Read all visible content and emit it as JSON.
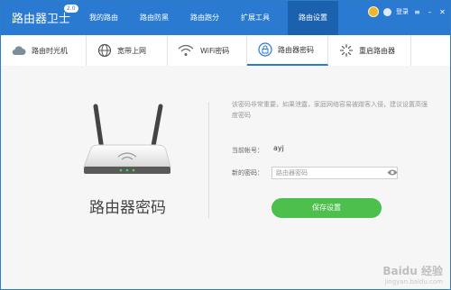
{
  "app": {
    "title": "路由器卫士",
    "version": "2.0"
  },
  "topnav": [
    {
      "label": "我的路由"
    },
    {
      "label": "路由防黑"
    },
    {
      "label": "路由跑分"
    },
    {
      "label": "扩展工具"
    },
    {
      "label": "路由设置",
      "active": true
    }
  ],
  "top_right": {
    "login_label": "登录"
  },
  "subtabs": [
    {
      "label": "路由时光机",
      "icon": "cloud-icon"
    },
    {
      "label": "宽带上网",
      "icon": "globe-icon"
    },
    {
      "label": "WiFi密码",
      "icon": "wifi-icon"
    },
    {
      "label": "路由器密码",
      "icon": "lock-icon",
      "active": true
    },
    {
      "label": "重启路由器",
      "icon": "restart-icon"
    }
  ],
  "main": {
    "router_title": "路由器密码",
    "info_text": "该密码非常重要，如果泄露，家庭网络容易被蹭客入侵，建议设置高强度密码",
    "account_label": "当前帐号：",
    "account_value": "ayj",
    "new_pwd_label": "新的密码：",
    "new_pwd_placeholder": "路由器密码",
    "save_label": "保存设置"
  },
  "watermark": {
    "text": "Baidu 经验",
    "sub": "jingyan.baidu.com"
  },
  "colors": {
    "brand": "#2a7ad1",
    "active_tab": "#1b62ae",
    "save": "#4cbf4c"
  }
}
